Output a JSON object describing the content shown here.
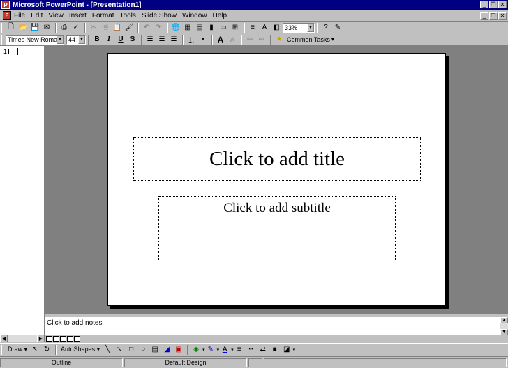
{
  "window": {
    "title": "Microsoft PowerPoint - [Presentation1]",
    "controls": [
      "minimize",
      "restore",
      "close"
    ]
  },
  "menubar": {
    "items": [
      "File",
      "Edit",
      "View",
      "Insert",
      "Format",
      "Tools",
      "Slide Show",
      "Window",
      "Help"
    ]
  },
  "toolbar_standard": {
    "zoom": "33%"
  },
  "toolbar_formatting": {
    "font": "Times New Roman",
    "size": "44",
    "bold": "B",
    "italic": "I",
    "underline": "U",
    "shadow": "S",
    "grow_font": "A",
    "common_tasks": "Common Tasks"
  },
  "outline": {
    "slide_number": "1"
  },
  "slide": {
    "title_placeholder": "Click to add title",
    "subtitle_placeholder": "Click to add subtitle"
  },
  "notes": {
    "placeholder": "Click to add notes"
  },
  "drawing_toolbar": {
    "draw_label": "Draw",
    "autoshapes_label": "AutoShapes"
  },
  "statusbar": {
    "view": "Outline",
    "design": "Default Design"
  },
  "colors": {
    "titlebar": "#000080",
    "workspace": "#808080",
    "chrome": "#c0c0c0"
  }
}
